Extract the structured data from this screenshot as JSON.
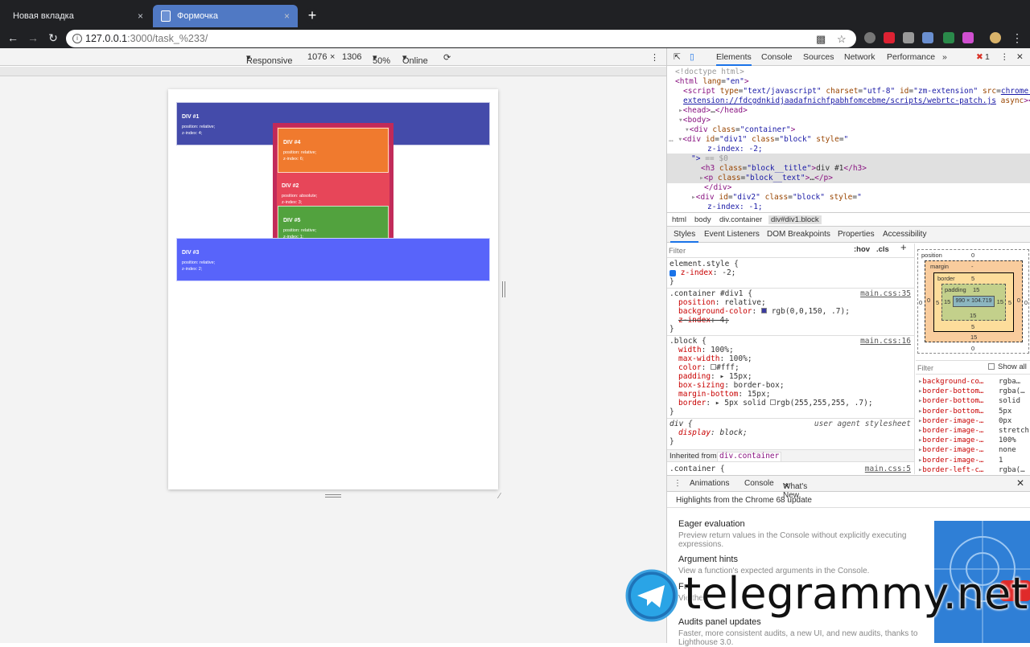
{
  "browser": {
    "tabs": [
      {
        "title": "Новая вкладка",
        "active": false
      },
      {
        "title": "Формочка",
        "active": true
      }
    ],
    "new_tab_symbol": "+",
    "close_symbol": "×",
    "url_host": "127.0.0.1",
    "url_path": ":3000/task_%233/",
    "icons": [
      "back-icon",
      "forward-icon",
      "reload-icon",
      "info-icon",
      "translate-icon",
      "star-icon"
    ]
  },
  "device_toolbar": {
    "mode": "Responsive",
    "width": "1076",
    "times": "×",
    "height": "1306",
    "zoom": "50%",
    "throttle": "Online"
  },
  "page": {
    "blocks": [
      {
        "id": "div1",
        "title": "DIV #1",
        "line1": "position: relative;",
        "line2": "z-index: 4;"
      },
      {
        "id": "div4",
        "title": "DIV #4",
        "line1": "position: relative;",
        "line2": "z-index: 6;"
      },
      {
        "id": "div2",
        "title": "DIV #2",
        "line1": "position: absolute;",
        "line2": "z-index: 3;"
      },
      {
        "id": "div5",
        "title": "DIV #5",
        "line1": "position: relative;",
        "line2": "z-index: 1;"
      },
      {
        "id": "div3",
        "title": "DIV #3",
        "line1": "position: relative;",
        "line2": "z-index: 2;"
      }
    ]
  },
  "devtools": {
    "tabs": [
      "Elements",
      "Console",
      "Sources",
      "Network",
      "Performance"
    ],
    "more": "»",
    "error_count": "1",
    "elements": {
      "doctype": "<!doctype html>",
      "script_src": "chrome-",
      "script_src2": "extension://fdcgdnkidjaadafnichfpabhfomcebme/scripts/webrtc-patch.js",
      "div1_style": "z-index: -2;",
      "eq0": "== $0",
      "h3_text": "div #1",
      "div2_style": "z-index: -1;"
    },
    "breadcrumbs": [
      "html",
      "body",
      "div.container",
      "div#div1.block"
    ],
    "subtabs": [
      "Styles",
      "Event Listeners",
      "DOM Breakpoints",
      "Properties",
      "Accessibility"
    ],
    "filter_placeholder": "Filter",
    "hov": ":hov",
    "cls": ".cls",
    "styles": {
      "element_style": "element.style {",
      "el_prop": "z-index",
      "el_val": "-2;",
      "r1_sel": ".container #div1 {",
      "r1_src": "main.css:35",
      "r1_p1": "position",
      "r1_v1": "relative;",
      "r1_p2": "background-color",
      "r1_v2": "rgb(0,0,150, .7);",
      "r1_p3": "z-index",
      "r1_v3": "4;",
      "r2_sel": ".block {",
      "r2_src": "main.css:16",
      "r2_p1": "width",
      "r2_v1": "100%;",
      "r2_p2": "max-width",
      "r2_v2": "100%;",
      "r2_p3": "color",
      "r2_v3": "#fff;",
      "r2_p4": "padding",
      "r2_v4": "15px;",
      "r2_p5": "box-sizing",
      "r2_v5": "border-box;",
      "r2_p6": "margin-bottom",
      "r2_v6": "15px;",
      "r2_p7": "border",
      "r2_v7": "5px solid",
      "r2_v7b": "rgb(255,255,255, .7);",
      "r3_sel": "div {",
      "r3_src": "user agent stylesheet",
      "r3_p1": "display",
      "r3_v1": "block;",
      "inherited": "Inherited from",
      "inherited_from": "div.container",
      "r4_sel": ".container {",
      "r4_src": "main.css:5",
      "close_brace": "}"
    },
    "boxmodel": {
      "position": "position",
      "position_val": "0",
      "margin": "margin",
      "margin_val": "-",
      "border": "border",
      "border_val": "5",
      "padding": "padding",
      "padding_val": "15",
      "content": "990 × 104.719",
      "side_15": "15",
      "side_5": "5",
      "side_0": "0"
    },
    "computed_filter": "Filter",
    "show_all": "Show all",
    "computed": [
      {
        "name": "background-co…",
        "value": "rgba…"
      },
      {
        "name": "border-bottom…",
        "value": "rgba(…"
      },
      {
        "name": "border-bottom…",
        "value": "solid"
      },
      {
        "name": "border-bottom…",
        "value": "5px"
      },
      {
        "name": "border-image-…",
        "value": "0px"
      },
      {
        "name": "border-image-…",
        "value": "stretch"
      },
      {
        "name": "border-image-…",
        "value": "100%"
      },
      {
        "name": "border-image-…",
        "value": "none"
      },
      {
        "name": "border-image-…",
        "value": "1"
      },
      {
        "name": "border-left-c…",
        "value": "rgba(…"
      }
    ],
    "drawer_tabs": [
      "Animations",
      "Console",
      "What's New"
    ],
    "whatsnew": {
      "highlight": "Highlights from the Chrome 68 update",
      "items": [
        {
          "title": "Eager evaluation",
          "text": "Preview return values in the Console without explicitly executing expressions."
        },
        {
          "title": "Argument hints",
          "text": "View a function's expected arguments in the Console."
        },
        {
          "title": "Fu",
          "text": "Vie the"
        },
        {
          "title": "Audits panel updates",
          "text": "Faster, more consistent audits, a new UI, and new audits, thanks to Lighthouse 3.0."
        }
      ]
    }
  },
  "watermark": "telegrammy.net",
  "colors": {
    "tab_active": "#5079c4",
    "div1": "#444baa",
    "div2": "#e63c50",
    "div3": "#5864fa",
    "div4": "#f07a2e",
    "div5": "#52a23e"
  }
}
